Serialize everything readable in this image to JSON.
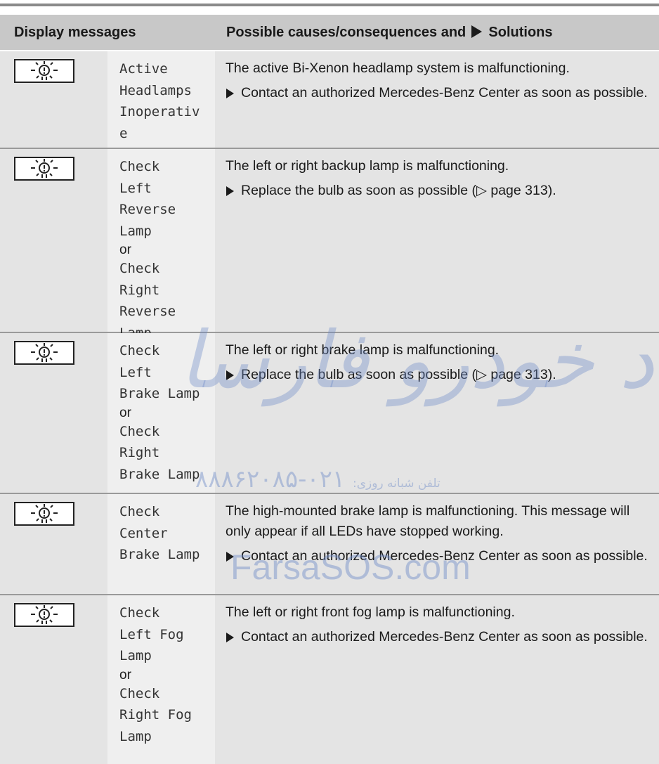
{
  "header": {
    "col1": "Display messages",
    "col2_before": "Possible causes/consequences and",
    "col2_after": "Solutions"
  },
  "rows": [
    {
      "icon": "lamp-fault-icon",
      "msg_lines": [
        "Active",
        "Headlamps",
        "Inoperativ",
        "e"
      ],
      "cause": "The active Bi-Xenon headlamp system is malfunctioning.",
      "solution": "Contact an authorized Mercedes-Benz Center as soon as possible."
    },
    {
      "icon": "lamp-fault-icon",
      "msg_lines_a": [
        "Check",
        "Left",
        "Reverse",
        "Lamp"
      ],
      "or": "or",
      "msg_lines_b": [
        "Check",
        "Right",
        "Reverse",
        "Lamp"
      ],
      "cause": "The left or right backup lamp is malfunctioning.",
      "solution": "Replace the bulb as soon as possible (▷ page 313)."
    },
    {
      "icon": "lamp-fault-icon",
      "msg_lines_a": [
        "Check",
        "Left",
        "Brake Lamp"
      ],
      "or": "or",
      "msg_lines_b": [
        "Check",
        "Right",
        "Brake Lamp"
      ],
      "cause": "The left or right brake lamp is malfunctioning.",
      "solution": "Replace the bulb as soon as possible (▷ page 313)."
    },
    {
      "icon": "lamp-fault-icon",
      "msg_lines": [
        "Check",
        "Center",
        "Brake Lamp"
      ],
      "cause": "The high-mounted brake lamp is malfunctioning. This message will only appear if all LEDs have stopped working.",
      "solution": "Contact an authorized Mercedes-Benz Center as soon as possible."
    },
    {
      "icon": "lamp-fault-icon",
      "msg_lines_a": [
        "Check",
        "Left Fog",
        "Lamp"
      ],
      "or": "or",
      "msg_lines_b": [
        "Check",
        "Right Fog",
        "Lamp"
      ],
      "cause": "The left or right front fog lamp is malfunctioning.",
      "solution": "Contact an authorized Mercedes-Benz Center as soon as possible."
    }
  ],
  "watermark": {
    "persian": "امداد خودرو فارسا",
    "phone_label": "تلفن شبانه روزی:",
    "phone": "۰۲۱-۸۸۸۶۲۰۸۵",
    "site": "FarsaSOS.com"
  },
  "colors": {
    "header_bg": "#c8c8c8",
    "icon_col_bg": "#e4e4e4",
    "msg_col_bg": "#efefef",
    "watermark": "#6e8cc8"
  }
}
